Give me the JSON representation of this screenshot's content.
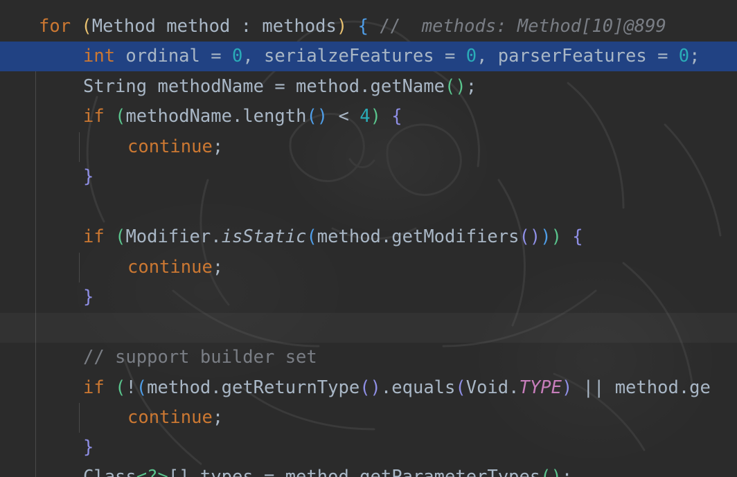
{
  "editor": {
    "lines": [
      {
        "tokens": [
          {
            "t": "for",
            "c": "kw"
          },
          {
            "t": " "
          },
          {
            "t": "(",
            "c": "p1"
          },
          {
            "t": "Method method : methods"
          },
          {
            "t": ")",
            "c": "p1"
          },
          {
            "t": " "
          },
          {
            "t": "{",
            "c": "p2"
          },
          {
            "t": " //  ",
            "c": "cmt"
          },
          {
            "t": "methods: Method[10]@899",
            "c": "hint"
          }
        ]
      },
      {
        "tokens": [
          {
            "t": "int",
            "c": "kw"
          },
          {
            "t": " ordinal = "
          },
          {
            "t": "0",
            "c": "num"
          },
          {
            "t": ", serialzeFeatures = "
          },
          {
            "t": "0",
            "c": "num"
          },
          {
            "t": ", parserFeatures = "
          },
          {
            "t": "0",
            "c": "num"
          },
          {
            "t": ";"
          }
        ]
      },
      {
        "tokens": [
          {
            "t": "String methodName = method.getName"
          },
          {
            "t": "()",
            "c": "p3"
          },
          {
            "t": ";"
          }
        ]
      },
      {
        "tokens": [
          {
            "t": "if",
            "c": "kw"
          },
          {
            "t": " "
          },
          {
            "t": "(",
            "c": "p3"
          },
          {
            "t": "methodName.length"
          },
          {
            "t": "()",
            "c": "p2"
          },
          {
            "t": " < "
          },
          {
            "t": "4",
            "c": "num"
          },
          {
            "t": ")",
            "c": "p3"
          },
          {
            "t": " "
          },
          {
            "t": "{",
            "c": "p4"
          }
        ]
      },
      {
        "tokens": [
          {
            "t": "continue",
            "c": "kw"
          },
          {
            "t": ";"
          }
        ]
      },
      {
        "tokens": [
          {
            "t": "}",
            "c": "p4"
          }
        ]
      },
      {
        "tokens": []
      },
      {
        "tokens": [
          {
            "t": "if",
            "c": "kw"
          },
          {
            "t": " "
          },
          {
            "t": "(",
            "c": "p3"
          },
          {
            "t": "Modifier."
          },
          {
            "t": "isStatic",
            "c": "static"
          },
          {
            "t": "(",
            "c": "p2"
          },
          {
            "t": "method.getModifiers"
          },
          {
            "t": "()",
            "c": "p4"
          },
          {
            "t": ")",
            "c": "p2"
          },
          {
            "t": ")",
            "c": "p3"
          },
          {
            "t": " "
          },
          {
            "t": "{",
            "c": "p4"
          }
        ]
      },
      {
        "tokens": [
          {
            "t": "continue",
            "c": "kw"
          },
          {
            "t": ";"
          }
        ]
      },
      {
        "tokens": [
          {
            "t": "}",
            "c": "p4"
          }
        ]
      },
      {
        "tokens": []
      },
      {
        "tokens": [
          {
            "t": "// support builder set",
            "c": "cmt"
          }
        ]
      },
      {
        "tokens": [
          {
            "t": "if",
            "c": "kw"
          },
          {
            "t": " "
          },
          {
            "t": "(",
            "c": "p3"
          },
          {
            "t": "!"
          },
          {
            "t": "(",
            "c": "p2"
          },
          {
            "t": "method.getReturnType"
          },
          {
            "t": "()",
            "c": "p4"
          },
          {
            "t": ".equals"
          },
          {
            "t": "(",
            "c": "p4"
          },
          {
            "t": "Void."
          },
          {
            "t": "TYPE",
            "c": "const"
          },
          {
            "t": ")",
            "c": "p4"
          },
          {
            "t": " || method.ge"
          }
        ]
      },
      {
        "tokens": [
          {
            "t": "continue",
            "c": "kw"
          },
          {
            "t": ";"
          }
        ]
      },
      {
        "tokens": [
          {
            "t": "}",
            "c": "p4"
          }
        ]
      },
      {
        "tokens": [
          {
            "t": "Class"
          },
          {
            "t": "<?>",
            "c": "p3"
          },
          {
            "t": "[] types = method.getParameterTypes"
          },
          {
            "t": "()",
            "c": "p3"
          },
          {
            "t": ";"
          }
        ]
      }
    ]
  },
  "colors": {
    "background": "#2b2b2b",
    "selection": "#214283",
    "keyword": "#cc7832",
    "number": "#2aacb8",
    "comment": "#7a7e85"
  }
}
